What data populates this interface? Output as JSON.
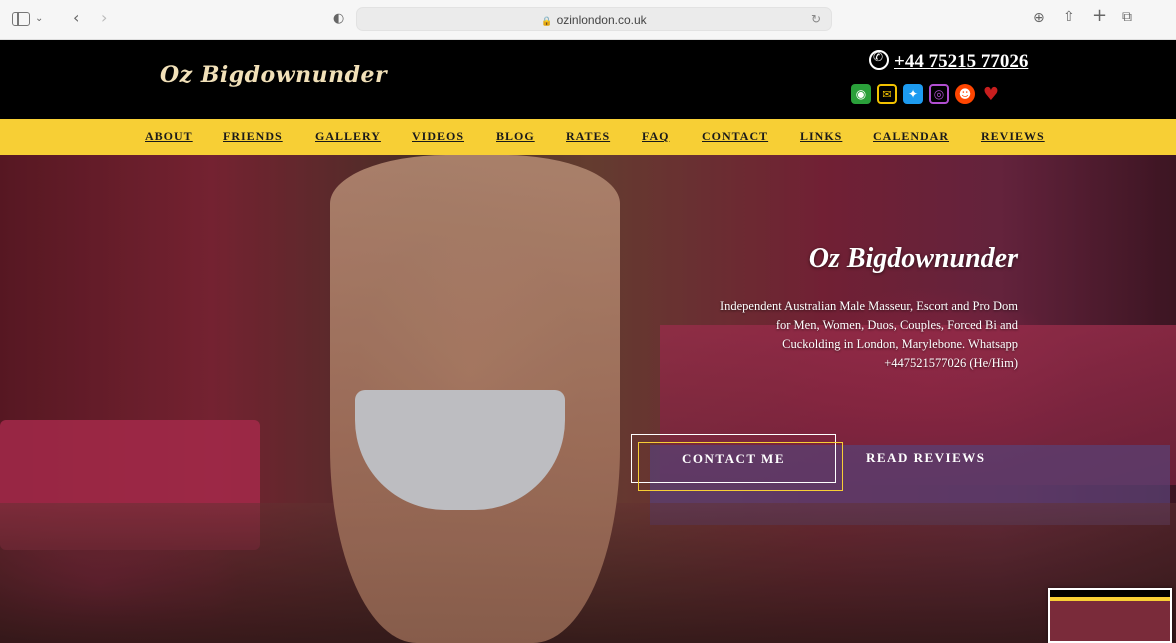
{
  "browser": {
    "url": "ozinlondon.co.uk"
  },
  "header": {
    "logo": "Oz Bigdownunder",
    "phone": "+44 75215 77026",
    "socials": [
      "rss-icon",
      "mail-icon",
      "twitter-icon",
      "instagram-icon",
      "reddit-icon",
      "devil-icon"
    ]
  },
  "nav": {
    "items": [
      "ABOUT",
      "FRIENDS",
      "GALLERY",
      "VIDEOS",
      "BLOG",
      "RATES",
      "FAQ",
      "CONTACT",
      "LINKS",
      "CALENDAR",
      "REVIEWS"
    ]
  },
  "hero": {
    "title": "Oz Bigdownunder",
    "description": "Independent Australian Male Masseur, Escort and Pro Dom for Men, Women, Duos, Couples, Forced Bi and Cuckolding in London, Marylebone. Whatsapp +447521577026 (He/Him)",
    "contact_button": "CONTACT ME",
    "reviews_button": "READ REVIEWS"
  },
  "colors": {
    "nav_bg": "#f7cf35",
    "header_bg": "#000000",
    "accent": "#f7cf35"
  }
}
